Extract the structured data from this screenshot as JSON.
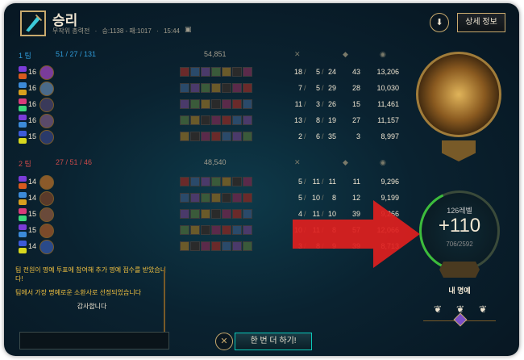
{
  "header": {
    "title": "승리",
    "mode": "무작위 총력전",
    "record": "승:1138 - 패:1017",
    "duration": "15:44",
    "detail_button": "상세 정보"
  },
  "teams": [
    {
      "label": "1 팀",
      "kda": "51 / 27 / 131",
      "gold": "54,851",
      "color": "#2f9bd8",
      "players": [
        {
          "level": "16",
          "k": "18",
          "d": "5",
          "a": "24",
          "cs": "43",
          "gold": "13,206"
        },
        {
          "level": "16",
          "k": "7",
          "d": "5",
          "a": "29",
          "cs": "28",
          "gold": "10,030"
        },
        {
          "level": "16",
          "k": "11",
          "d": "3",
          "a": "26",
          "cs": "15",
          "gold": "11,461"
        },
        {
          "level": "16",
          "k": "13",
          "d": "8",
          "a": "19",
          "cs": "27",
          "gold": "11,157"
        },
        {
          "level": "15",
          "k": "2",
          "d": "6",
          "a": "35",
          "cs": "3",
          "gold": "8,997"
        }
      ]
    },
    {
      "label": "2 팀",
      "kda": "27 / 51 / 46",
      "gold": "48,540",
      "color": "#c94a4a",
      "players": [
        {
          "level": "14",
          "k": "5",
          "d": "11",
          "a": "11",
          "cs": "11",
          "gold": "9,296"
        },
        {
          "level": "14",
          "k": "5",
          "d": "10",
          "a": "8",
          "cs": "12",
          "gold": "9,199"
        },
        {
          "level": "15",
          "k": "4",
          "d": "11",
          "a": "10",
          "cs": "39",
          "gold": "9,266"
        },
        {
          "level": "15",
          "k": "10",
          "d": "11",
          "a": "8",
          "cs": "57",
          "gold": "12,066"
        },
        {
          "level": "14",
          "k": "3",
          "d": "8",
          "a": "9",
          "cs": "39",
          "gold": "8,713"
        }
      ]
    }
  ],
  "level_panel": {
    "level_label": "126레벨",
    "gain": "+110",
    "exp": "706/2592"
  },
  "honor": {
    "title": "내 명예"
  },
  "chat": {
    "messages": [
      "팀 전원이 명예 투표에 참여해 추가 명예 점수를 받았습니다!",
      "팀에서 가장 명예로운 소환사로 선정되었습니다"
    ],
    "thanks": "감사합니다"
  },
  "bottom": {
    "play_again": "한 번 더 하기!"
  },
  "colors": {
    "gold_accent": "#c8aa6e",
    "blue_team": "#2f9bd8",
    "red_team": "#c94a4a",
    "annotation_arrow": "#e0201e",
    "chat_text": "#f0c040"
  }
}
